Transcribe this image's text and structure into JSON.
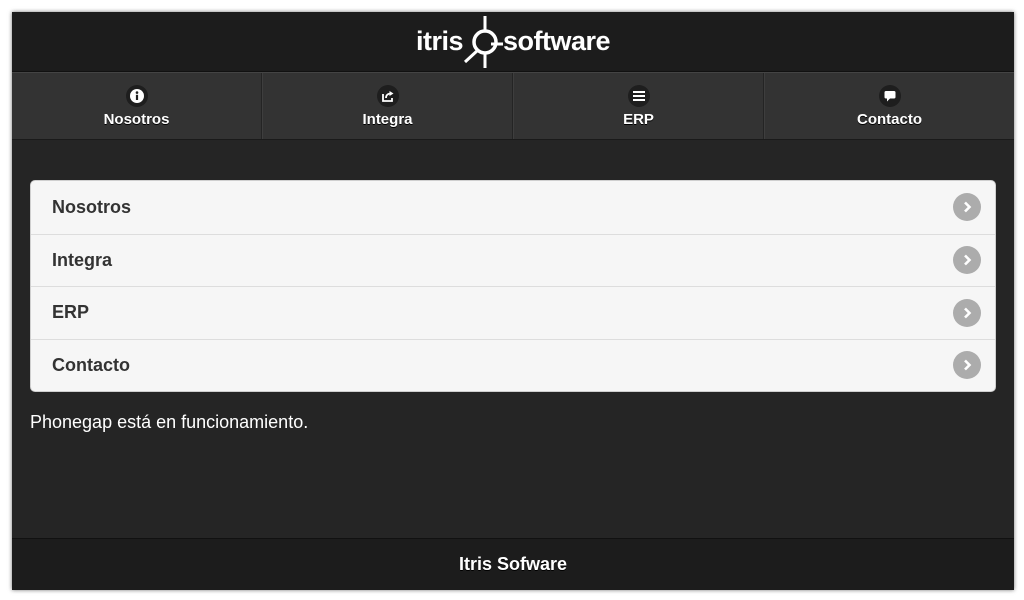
{
  "header": {
    "logo_left": "itris",
    "logo_right": "software"
  },
  "navbar": {
    "items": [
      {
        "label": "Nosotros",
        "icon": "info-icon"
      },
      {
        "label": "Integra",
        "icon": "share-icon"
      },
      {
        "label": "ERP",
        "icon": "bars-icon"
      },
      {
        "label": "Contacto",
        "icon": "comment-icon"
      }
    ]
  },
  "list": {
    "items": [
      {
        "label": "Nosotros"
      },
      {
        "label": "Integra"
      },
      {
        "label": "ERP"
      },
      {
        "label": "Contacto"
      }
    ]
  },
  "status_text": "Phonegap está en funcionamiento.",
  "footer": {
    "title": "Itris Sofware"
  },
  "colors": {
    "background": "#252525",
    "header": "#1c1c1c",
    "navbar": "#333333",
    "list_bg": "#f6f6f6",
    "arrow": "#acacac"
  }
}
